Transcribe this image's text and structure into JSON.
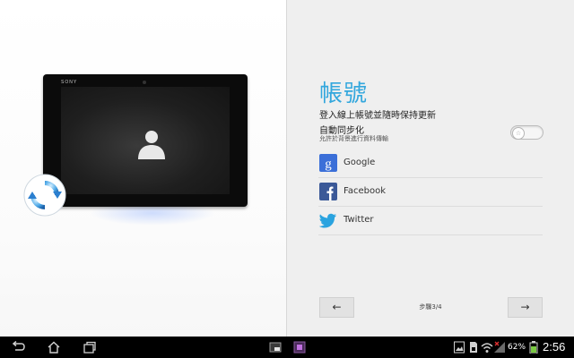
{
  "device": {
    "brand": "SONY"
  },
  "setup": {
    "title": "帳號",
    "description": "登入線上帳號並隨時保持更新",
    "autosync": {
      "label": "自動同步化",
      "sublabel": "允許於背景進行資料傳輸",
      "enabled": false
    },
    "accounts": [
      {
        "name": "Google",
        "icon": "google-icon",
        "color": "#3b6fd8"
      },
      {
        "name": "Facebook",
        "icon": "facebook-icon",
        "color": "#3b5998"
      },
      {
        "name": "Twitter",
        "icon": "twitter-icon",
        "color": "#2aa3df"
      }
    ],
    "step_label": "步驟3/4",
    "prev_icon": "arrow-left-icon",
    "next_icon": "arrow-right-icon"
  },
  "system_bar": {
    "nav_icons": [
      "back-icon",
      "home-icon",
      "recent-apps-icon"
    ],
    "small_apps_icons": [
      "small-app-icon",
      "small-app-icon"
    ],
    "status_icons": [
      "gallery-icon",
      "sim-icon",
      "wifi-icon",
      "signal-icon"
    ],
    "battery": "62%",
    "time": "2:56"
  },
  "colors": {
    "accent": "#33a7dd",
    "background_right": "#efefef",
    "system_bar": "#000000"
  }
}
